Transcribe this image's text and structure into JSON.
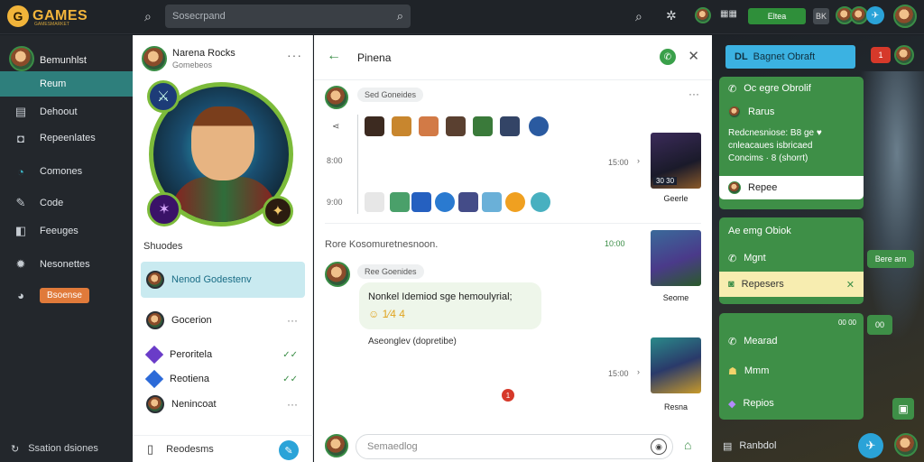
{
  "app": {
    "logo_text": "GAMES",
    "logo_sub": "GAMESMARKET",
    "logo_badge": "G"
  },
  "topbar": {
    "search_placeholder": "Sosecrpand",
    "right_chip_green": "Eltea",
    "right_chip_dark": "BK"
  },
  "leftnav": {
    "user_name": "Bemunhlst",
    "user_status": "Reum",
    "items": [
      {
        "label": "Dehoout",
        "icon": "book-icon"
      },
      {
        "label": "Repeenlates",
        "icon": "chat-icon"
      },
      {
        "label": "Comones",
        "icon": "comment-icon"
      },
      {
        "label": "Code",
        "icon": "scroll-icon"
      },
      {
        "label": "Feeuges",
        "icon": "bookmark-icon"
      },
      {
        "label": "Nesonettes",
        "icon": "gear-icon"
      },
      {
        "label": "Bsoense",
        "icon": "clock-icon"
      }
    ],
    "footer": "Ssation dsiones"
  },
  "contacts": {
    "header_name": "Narena Rocks",
    "header_sub": "Gomebeos",
    "section_label": "Shuodes",
    "items": [
      {
        "label": "Nenod Godestenv",
        "active": true,
        "tail": ""
      },
      {
        "label": "Gocerion",
        "active": false,
        "tail": "···"
      },
      {
        "label": "Peroritela",
        "active": false,
        "tail": "✓✓"
      },
      {
        "label": "Reotiena",
        "active": false,
        "tail": "✓✓"
      },
      {
        "label": "Nenincoat",
        "active": false,
        "tail": "···"
      }
    ],
    "footer": "Reodesms"
  },
  "chat": {
    "title": "Pinena",
    "msg1_tag": "Sed Goneides",
    "time1": "8:00",
    "time2": "9:00",
    "stamp1": "15:00",
    "card1_caption": "Geerle",
    "card1_badge": "30  30",
    "system_text": "Rore Kosomuretnesnoon.",
    "system_time": "10:00",
    "msg2_tag": "Ree Goenides",
    "bubble_text": "Nonkel Idemiod sge hemoulyrial;",
    "bubble_emoji_tail": "☺ 1⁄4 4",
    "below_bubble": "Aseonglev (dopretibe)",
    "card2_caption": "Seome",
    "card3_caption": "Resna",
    "stamp2": "15:00",
    "unread": "1",
    "input_placeholder": "Semaedlog"
  },
  "rpanel": {
    "pin_label": "Bagnet Obraft",
    "pin_icon": "DL",
    "panel1_title": "Oc egre Obrolif",
    "panel1_row": "Rarus",
    "panel1_text": "Redcnesniose: B8 ge ♥\ncnleacaues isbricaed\nConcims · 8 (shorrt)",
    "panel1_footer": "Repee",
    "panel2_title": "Ae emg Obiok",
    "panel2_row1": "Mgnt",
    "panel2_row2": "Repesers",
    "panel2_side_chip": "Bere arn",
    "panel3_chip": "00 00",
    "panel3_rows": [
      "Mearad",
      "Mmm",
      "Repios"
    ],
    "panel3_side_chip": "00",
    "footer_label": "Ranbdol",
    "badge_red": "1"
  }
}
